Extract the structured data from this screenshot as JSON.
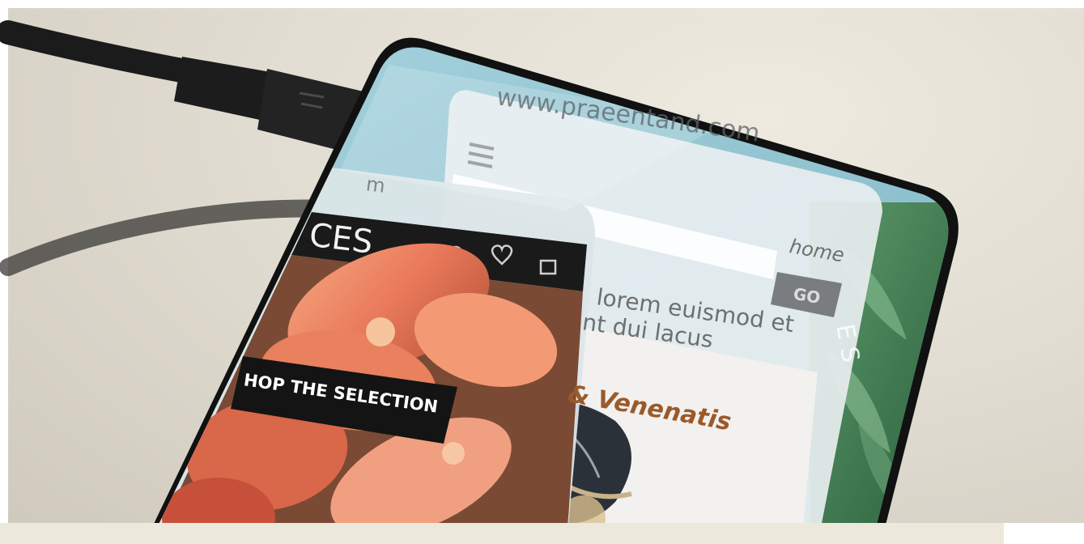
{
  "photo": {
    "subject": "phone-with-transparent-browser-screens",
    "colors": {
      "background": "#e4e0d6",
      "cable": "#1b1b1b",
      "phone_frame": "#111111",
      "screen_tint": "#9ccbd6",
      "flower": "#ef8a64",
      "leaf": "#3a7a4e"
    }
  },
  "back_window": {
    "url_text": "www.praeentand.com",
    "nav_link": "home",
    "go_button": "GO",
    "body_line_1": "lorem euismod et",
    "body_line_2": "nt dui lacus",
    "heading": "& Venenatis",
    "side_text": "E S"
  },
  "front_window": {
    "tab_fragment": "m",
    "brand_fragment": "CES",
    "cta_label": "HOP THE SELECTION"
  }
}
